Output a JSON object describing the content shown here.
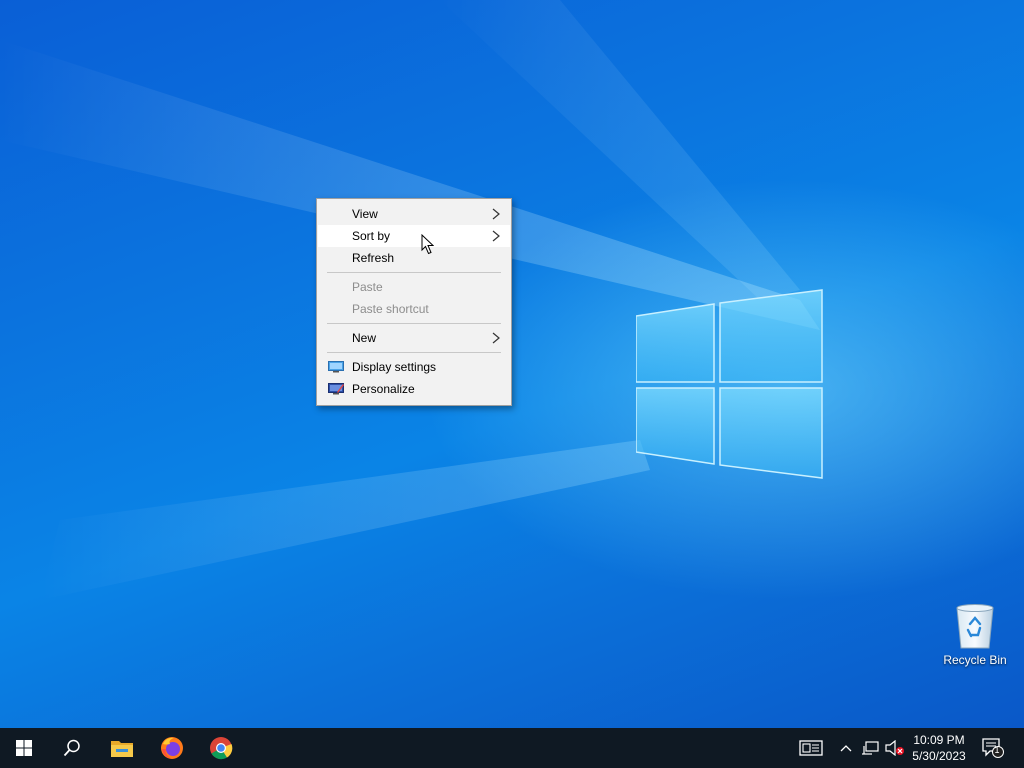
{
  "desktop": {
    "recycle_bin_label": "Recycle Bin"
  },
  "context_menu": {
    "items": [
      {
        "label": "View",
        "submenu": true,
        "enabled": true
      },
      {
        "label": "Sort by",
        "submenu": true,
        "enabled": true,
        "highlighted": true
      },
      {
        "label": "Refresh",
        "submenu": false,
        "enabled": true
      },
      {
        "label": "Paste",
        "submenu": false,
        "enabled": false
      },
      {
        "label": "Paste shortcut",
        "submenu": false,
        "enabled": false
      },
      {
        "label": "New",
        "submenu": true,
        "enabled": true
      },
      {
        "label": "Display settings",
        "icon": "display-icon",
        "enabled": true
      },
      {
        "label": "Personalize",
        "icon": "personalize-icon",
        "enabled": true
      }
    ]
  },
  "taskbar": {
    "pinned": [
      {
        "name": "start-button",
        "icon": "windows-logo-icon"
      },
      {
        "name": "search-button",
        "icon": "search-icon"
      },
      {
        "name": "file-explorer",
        "icon": "folder-icon"
      },
      {
        "name": "firefox",
        "icon": "firefox-icon"
      },
      {
        "name": "chrome",
        "icon": "chrome-icon"
      }
    ],
    "tray": {
      "time": "10:09 PM",
      "date": "5/30/2023",
      "notification_count": "1"
    }
  },
  "colors": {
    "taskbar": "#0f1923",
    "menu_bg": "#f2f2f2",
    "desktop_blue": "#0b73de"
  }
}
